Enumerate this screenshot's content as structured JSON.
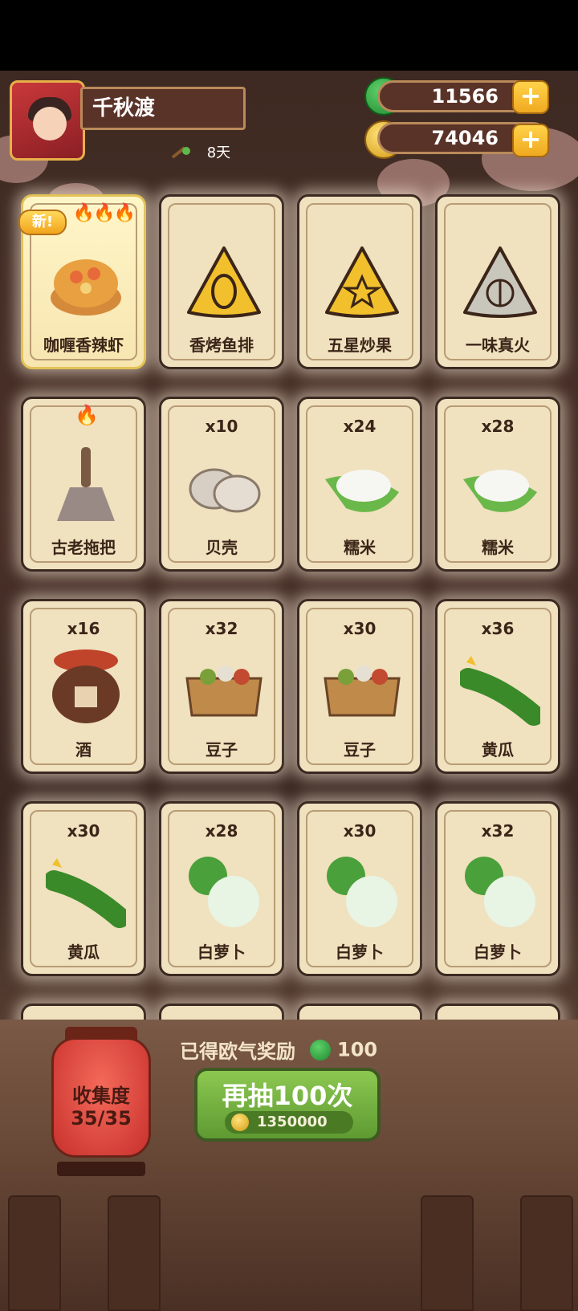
{
  "player": {
    "name": "千秋渡",
    "days": "8天"
  },
  "resources": {
    "jade": "11566",
    "coins": "74046",
    "plus": "+"
  },
  "cards": [
    {
      "name": "咖喱香辣虾",
      "count": "",
      "new_label": "新!",
      "flames": "🔥🔥🔥",
      "icon": "curry-shrimp-icon"
    },
    {
      "name": "香烤鱼排",
      "count": "",
      "icon": "fish-triangle-icon"
    },
    {
      "name": "五星炒果",
      "count": "",
      "icon": "star-triangle-icon"
    },
    {
      "name": "一味真火",
      "count": "",
      "icon": "flame-leaf-triangle-icon"
    },
    {
      "name": "古老拖把",
      "count": "",
      "flames": "🔥",
      "icon": "mop-icon"
    },
    {
      "name": "贝壳",
      "count": "x10",
      "icon": "shell-icon"
    },
    {
      "name": "糯米",
      "count": "x24",
      "icon": "rice-icon"
    },
    {
      "name": "糯米",
      "count": "x28",
      "icon": "rice-icon"
    },
    {
      "name": "酒",
      "count": "x16",
      "icon": "wine-jar-icon"
    },
    {
      "name": "豆子",
      "count": "x32",
      "icon": "beans-box-icon"
    },
    {
      "name": "豆子",
      "count": "x30",
      "icon": "beans-box-icon"
    },
    {
      "name": "黄瓜",
      "count": "x36",
      "icon": "cucumber-icon"
    },
    {
      "name": "黄瓜",
      "count": "x30",
      "icon": "cucumber-icon"
    },
    {
      "name": "白萝卜",
      "count": "x28",
      "icon": "radish-icon"
    },
    {
      "name": "白萝卜",
      "count": "x30",
      "icon": "radish-icon"
    },
    {
      "name": "白萝卜",
      "count": "x32",
      "icon": "radish-icon"
    }
  ],
  "collection": {
    "label": "收集度",
    "progress": "35/35"
  },
  "reward": {
    "label": "已得欧气奖励",
    "amount": "100"
  },
  "draw_button": {
    "label": "再抽100次",
    "cost": "1350000"
  }
}
